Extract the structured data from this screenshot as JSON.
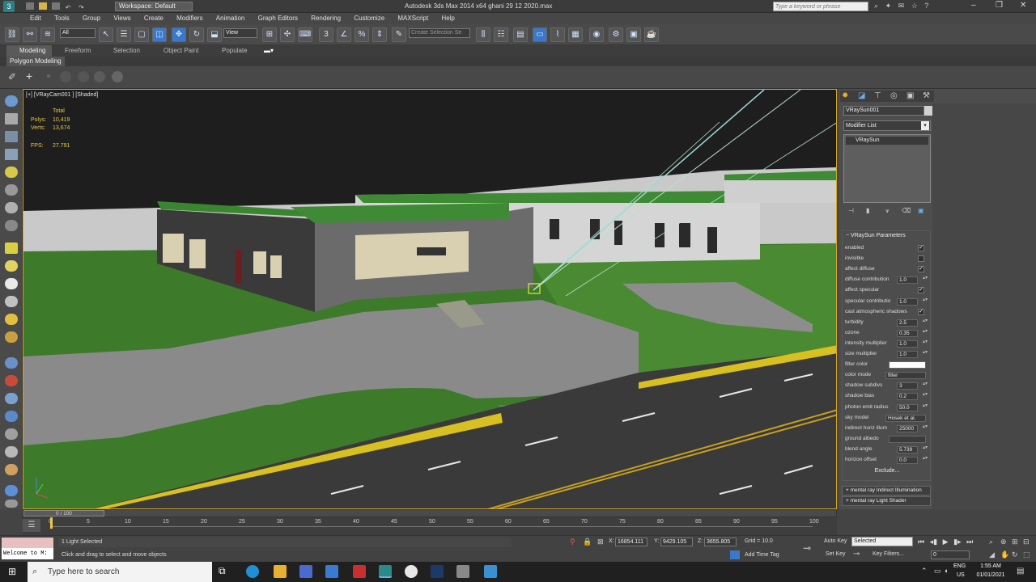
{
  "window": {
    "title": "Autodesk 3ds Max  2014 x64     ghani 29 12 2020.max",
    "workspace": "Workspace: Default",
    "search_placeholder": "Type a keyword or phrase"
  },
  "menu": [
    "Edit",
    "Tools",
    "Group",
    "Views",
    "Create",
    "Modifiers",
    "Animation",
    "Graph Editors",
    "Rendering",
    "Customize",
    "MAXScript",
    "Help"
  ],
  "toolbar": {
    "selection_filter": "All",
    "ref_coord": "View",
    "named_selection_placeholder": "Create Selection Se"
  },
  "ribbon": {
    "tabs": [
      "Modeling",
      "Freeform",
      "Selection",
      "Object Paint",
      "Populate"
    ],
    "active_panel": "Polygon Modeling"
  },
  "viewport": {
    "label": "[+] [VRayCam001 ] [Shaded]",
    "stats_header": "Total",
    "polys_label": "Polys:",
    "polys_value": "10,419",
    "verts_label": "Verts:",
    "verts_value": "13,674",
    "fps_label": "FPS:",
    "fps_value": "27.791"
  },
  "command_panel": {
    "object_name": "VRaySun001",
    "modifier_list": "Modifier List",
    "stack_item": "VRaySun",
    "rollout_title": "VRaySun Parameters",
    "params": [
      {
        "label": "enabled",
        "type": "check",
        "value": "✓"
      },
      {
        "label": "invisible",
        "type": "check",
        "value": ""
      },
      {
        "label": "affect diffuse",
        "type": "check",
        "value": "✓"
      },
      {
        "label": "diffuse contribution",
        "type": "num",
        "value": "1.0"
      },
      {
        "label": "affect specular",
        "type": "check",
        "value": "✓"
      },
      {
        "label": "specular contributio",
        "type": "num",
        "value": "1.0"
      },
      {
        "label": "cast atmospheric shadows",
        "type": "check",
        "value": "✓"
      },
      {
        "label": "turbidity",
        "type": "num",
        "value": "2.5"
      },
      {
        "label": "ozone",
        "type": "num",
        "value": "0.35"
      },
      {
        "label": "intensity multiplier",
        "type": "num",
        "value": "1.0"
      },
      {
        "label": "size multiplier",
        "type": "num",
        "value": "1.0"
      },
      {
        "label": "filter color",
        "type": "color",
        "value": ""
      },
      {
        "label": "color mode",
        "type": "drop",
        "value": "filter"
      },
      {
        "label": "shadow subdivs",
        "type": "num",
        "value": "3"
      },
      {
        "label": "shadow bias",
        "type": "num",
        "value": "0.2"
      },
      {
        "label": "photon emit radius",
        "type": "num",
        "value": "50.0"
      },
      {
        "label": "sky model",
        "type": "drop",
        "value": "Hosek et al."
      },
      {
        "label": "indirect horiz illum",
        "type": "num",
        "value": "25000"
      },
      {
        "label": "ground albedo",
        "type": "color",
        "value": ""
      },
      {
        "label": "blend angle",
        "type": "num",
        "value": "5.739"
      },
      {
        "label": "horizon offset",
        "type": "num",
        "value": "0.0"
      }
    ],
    "exclude_button": "Exclude...",
    "rollout2": "mental ray Indirect Illumination",
    "rollout3": "mental ray Light Shader"
  },
  "timeline": {
    "frame_slider": "0 / 100",
    "ticks": [
      "0",
      "5",
      "10",
      "15",
      "20",
      "25",
      "30",
      "35",
      "40",
      "45",
      "50",
      "55",
      "60",
      "65",
      "70",
      "75",
      "80",
      "85",
      "90",
      "95",
      "100"
    ]
  },
  "status": {
    "selected": "1 Light Selected",
    "prompt": "Click and drag to select and move objects",
    "x_label": "X:",
    "x_value": "16854.111",
    "y_label": "Y:",
    "y_value": "9429.105",
    "z_label": "Z:",
    "z_value": "3655.805",
    "grid": "Grid = 10.0",
    "add_time_tag": "Add Time Tag",
    "auto_key": "Auto Key",
    "set_key": "Set Key",
    "key_mode": "Selected",
    "key_filters": "Key Filters...",
    "frame": "0",
    "maxscript": "Welcome to M:"
  },
  "taskbar": {
    "search": "Type here to search",
    "lang1": "ENG",
    "lang2": "US",
    "time": "1:55 AM",
    "date": "01/01/2021"
  },
  "colors": {
    "accent": "#3a78c9",
    "viewport_border": "#d4a52a",
    "grass": "#3d7a2a",
    "road": "#3a3a3a"
  }
}
